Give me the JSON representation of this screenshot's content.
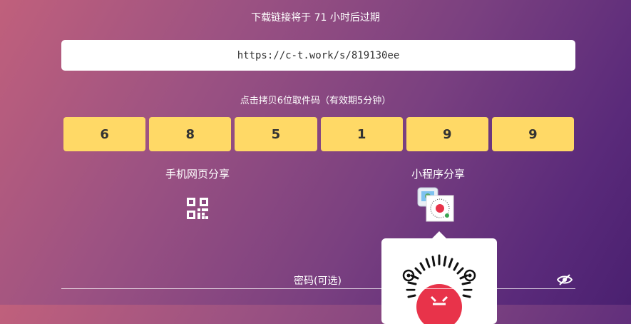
{
  "expire_text": "下载链接将于 71 小时后过期",
  "share_link": "https://c-t.work/s/819130ee",
  "copy_hint": "点击拷贝6位取件码（有效期5分钟）",
  "pickup_code": [
    "6",
    "8",
    "5",
    "1",
    "9",
    "9"
  ],
  "share": {
    "web_label": "手机网页分享",
    "web_icon": "qr-code-icon",
    "mini_label": "小程序分享",
    "mini_icon": "mini-program-icon"
  },
  "password": {
    "label": "密码(可选)",
    "toggle_icon": "eye-slash-icon"
  },
  "colors": {
    "code_cell": "#ffd966",
    "popup_accent": "#e8334a"
  }
}
